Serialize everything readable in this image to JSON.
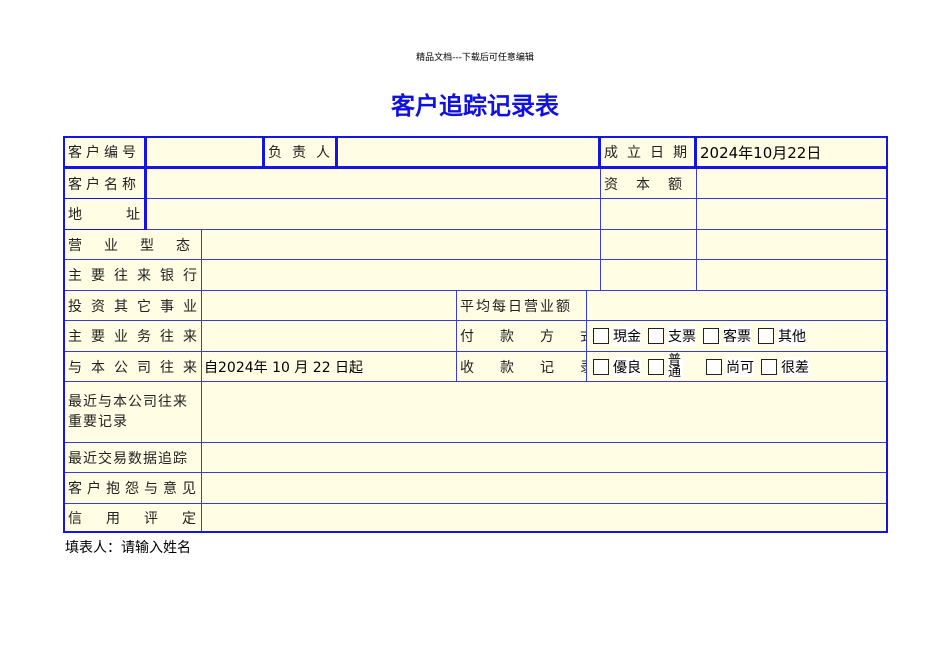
{
  "header_note": "精品文档---下载后可任意编辑",
  "title": "客户追踪记录表",
  "labels": {
    "customer_no": "客户编号",
    "person_in_charge": "负责人",
    "established_date": "成立日期",
    "customer_name": "客户名称",
    "capital": "资本额",
    "address": "地址",
    "business_type": "营业型态",
    "main_bank": "主要往来银行",
    "other_investments": "投资其它事业",
    "avg_daily_sales": "平均每日营业额",
    "main_business": "主要业务往来",
    "payment_method": "付款方式",
    "dealings_since": "与本公司往来",
    "collection_record": "收款记录",
    "important_records": "最近与本公司往来重要记录",
    "recent_trading": "最近交易数据追踪",
    "complaints": "客户抱怨与意见",
    "credit_rating": "信用评定"
  },
  "values": {
    "established_date": "2024年10月22日",
    "dealings_since": "自2024年 10 月 22 日起"
  },
  "payment_options": [
    "現金",
    "支票",
    "客票",
    "其他"
  ],
  "collection_options": [
    "優良",
    "普通",
    "尚可",
    "很差"
  ],
  "footer": {
    "label": "填表人：",
    "value": "请输入姓名"
  }
}
